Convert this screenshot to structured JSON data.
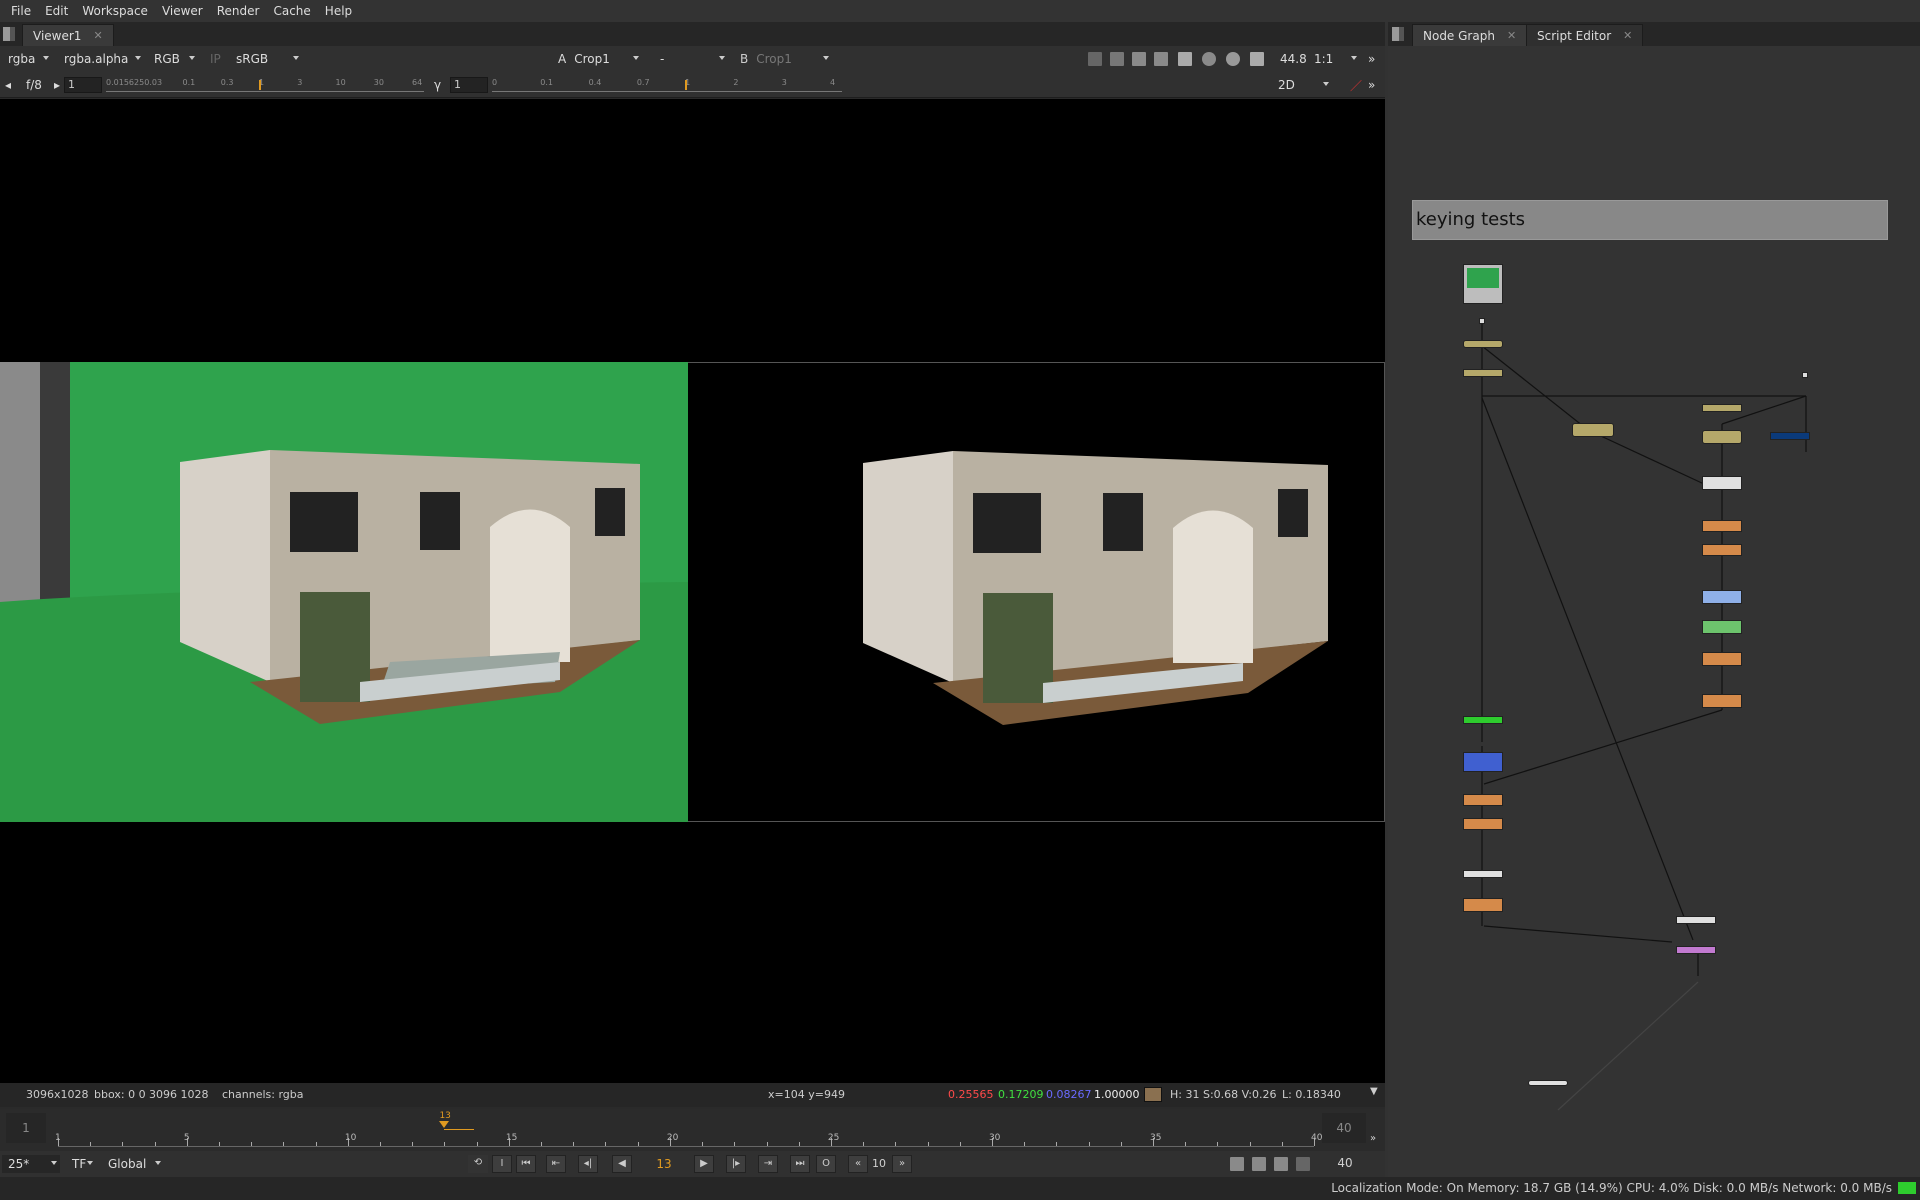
{
  "menu": [
    "File",
    "Edit",
    "Workspace",
    "Viewer",
    "Render",
    "Cache",
    "Help"
  ],
  "viewer": {
    "tab_label": "Viewer1",
    "channels": "rgba",
    "alpha": "rgba.alpha",
    "display_channels": "RGB",
    "ip": "IP",
    "lut": "sRGB",
    "input_a_label": "A",
    "input_a": "Crop1",
    "composite_op": "-",
    "input_b_label": "B",
    "input_b": "Crop1",
    "fps": "44.8",
    "zoom": "1:1",
    "fstop": "f/8",
    "gain_value": "1",
    "gamma_label": "γ",
    "gamma_value": "1",
    "view_mode": "2D",
    "gain_ticks": [
      "0.015625",
      "0.03",
      "0.1",
      "0.3",
      "1",
      "3",
      "10",
      "30",
      "64"
    ],
    "gamma_ticks": [
      "0",
      "0.1",
      "0.4",
      "0.7",
      "1",
      "2",
      "3",
      "4"
    ]
  },
  "info": {
    "format": "3096x1028",
    "bbox": "bbox: 0 0 3096 1028",
    "channels": "channels: rgba",
    "coords": "x=104 y=949",
    "r": "0.25565",
    "g": "0.17209",
    "b": "0.08267",
    "a": "1.00000",
    "hsv": "H: 31 S:0.68 V:0.26",
    "lum": "L: 0.18340",
    "sample_color": "#8a7050"
  },
  "timeline": {
    "start": "1",
    "end": "40",
    "end_right": "40",
    "ticks": [
      "1",
      "5",
      "10",
      "15",
      "20",
      "25",
      "30",
      "35",
      "40"
    ],
    "current": "13",
    "fps": "25*",
    "tf": "TF",
    "range": "Global",
    "current_frame": "13",
    "step": "10",
    "last_frame": "40"
  },
  "right": {
    "tab_graph": "Node Graph",
    "tab_script": "Script Editor",
    "backdrop_label": "keying tests"
  },
  "status": {
    "text": "Localization Mode: On  Memory: 18.7 GB (14.9%)  CPU: 4.0%  Disk: 0.0 MB/s  Network: 0.0 MB/s"
  }
}
